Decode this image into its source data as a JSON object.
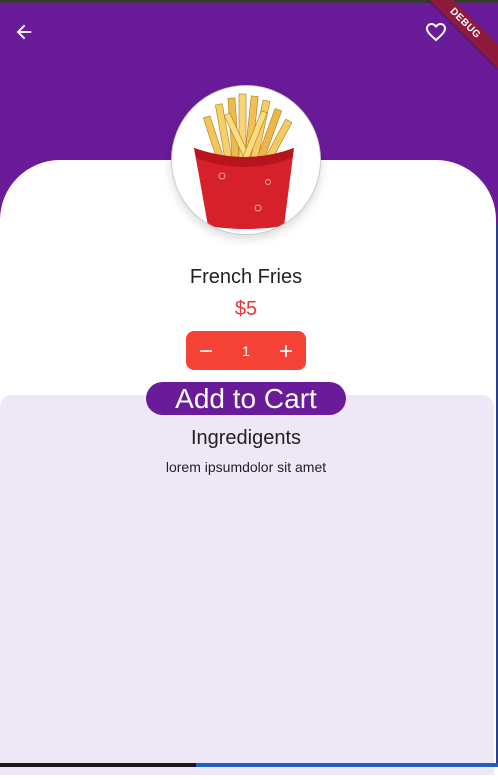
{
  "appbar": {
    "back_icon": "arrow-left-icon",
    "favorite_icon": "heart-outline-icon",
    "debug_banner": "DEBUG"
  },
  "product": {
    "image_icon": "french-fries-image",
    "name": "French Fries",
    "price": "$5"
  },
  "quantity": {
    "value": "1",
    "decrement_icon": "minus-icon",
    "increment_icon": "plus-icon"
  },
  "actions": {
    "add_to_cart_label": "Add to Cart"
  },
  "ingredients": {
    "title": "Ingredigents",
    "description": "lorem ipsumdolor sit amet"
  },
  "colors": {
    "primary": "#6a1b9a",
    "accent": "#f44336",
    "price": "#e53935",
    "panel": "#ede7f6"
  }
}
